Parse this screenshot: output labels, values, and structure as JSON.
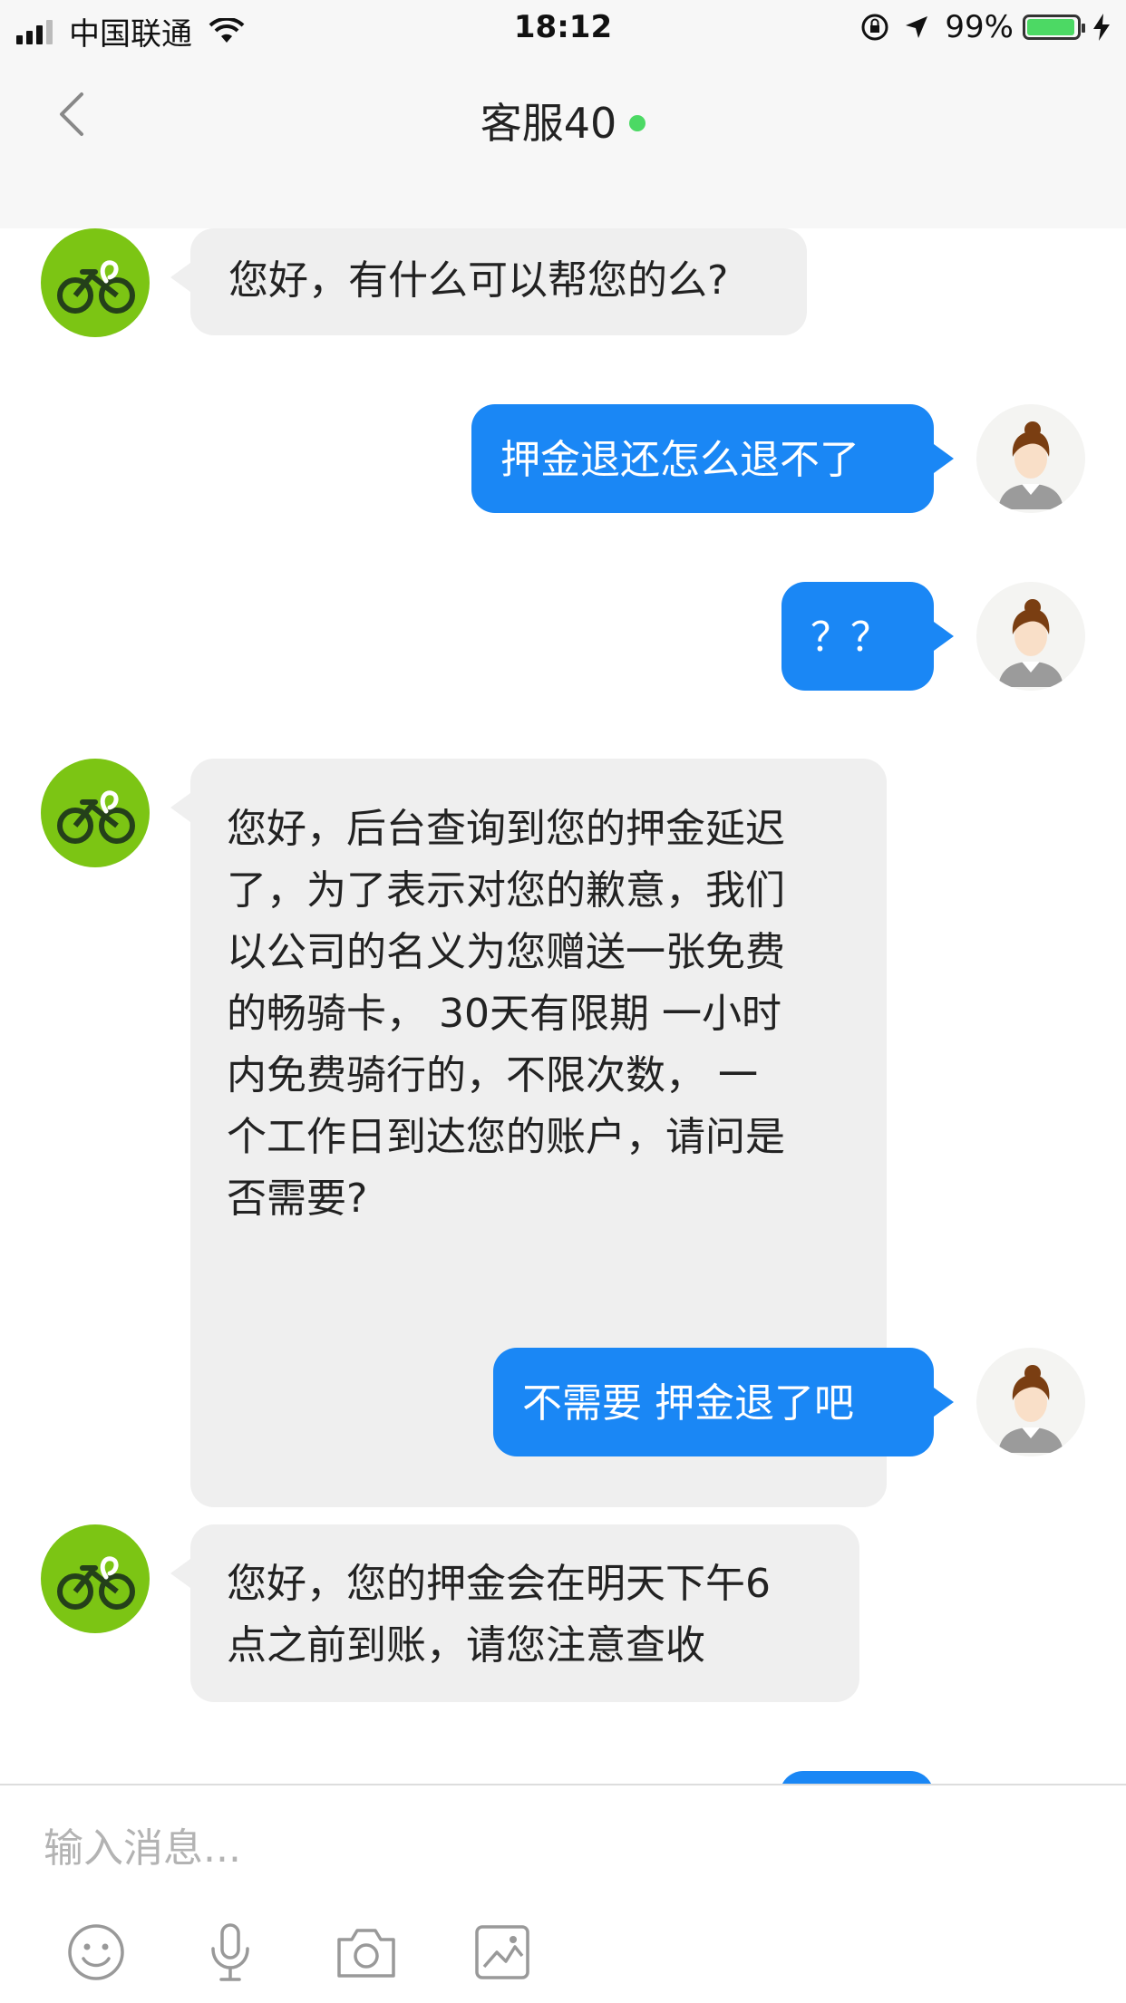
{
  "status_bar": {
    "carrier": "中国联通",
    "time": "18:12",
    "battery": "99%"
  },
  "header": {
    "title": "客服40",
    "online_color": "#4cd964"
  },
  "messages": [
    {
      "sender": "agent",
      "text": "您好，有什么可以帮您的么?"
    },
    {
      "sender": "user",
      "text": "押金退还怎么退不了"
    },
    {
      "sender": "user",
      "text": "？？"
    },
    {
      "sender": "agent",
      "lines": [
        "您好，后台查询到您的押金延迟",
        "了，为了表示对您的歉意，我们",
        "以公司的名义为您赠送一张免费",
        "的畅骑卡， 30天有限期 一小时",
        "内免费骑行的，不限次数， 一",
        "个工作日到达您的账户，请问是",
        "否需要?"
      ]
    },
    {
      "sender": "user",
      "text": "不需要  押金退了吧"
    },
    {
      "sender": "agent",
      "lines": [
        "您好，您的押金会在明天下午6",
        "点之前到账，请您注意查收"
      ]
    }
  ],
  "input": {
    "placeholder": "输入消息..."
  },
  "toolbar": {
    "icons": [
      "emoji-icon",
      "microphone-icon",
      "camera-icon",
      "image-icon"
    ]
  },
  "colors": {
    "outgoing_bubble": "#1a87f5",
    "incoming_bubble": "#efefef",
    "bot_avatar": "#7cc514"
  }
}
